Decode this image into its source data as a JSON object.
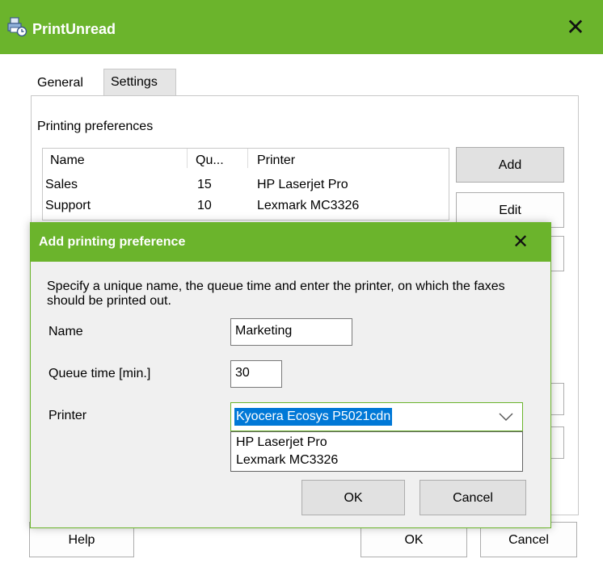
{
  "window": {
    "title": "PrintUnread",
    "app_icon": "printer-clock-icon",
    "close_glyph": "✕"
  },
  "tabs": [
    {
      "label": "General",
      "selected": false
    },
    {
      "label": "Settings",
      "selected": true
    }
  ],
  "settings": {
    "section_label": "Printing preferences",
    "columns": [
      "Name",
      "Qu...",
      "Printer"
    ],
    "rows": [
      {
        "name": "Sales",
        "queue": "15",
        "printer": "HP Laserjet Pro"
      },
      {
        "name": "Support",
        "queue": "10",
        "printer": "Lexmark MC3326"
      }
    ],
    "buttons": {
      "add": "Add",
      "edit": "Edit"
    }
  },
  "footer": {
    "help": "Help",
    "ok": "OK",
    "cancel": "Cancel"
  },
  "dialog": {
    "title": "Add printing preference",
    "close_glyph": "✕",
    "description": "Specify a unique name, the queue time and enter the printer, on which the faxes should be printed out.",
    "name_label": "Name",
    "name_value": "Marketing",
    "queue_label": "Queue time [min.]",
    "queue_value": "30",
    "printer_label": "Printer",
    "printer_value": "Kyocera Ecosys P5021cdn",
    "printer_options": [
      "HP Laserjet Pro",
      "Lexmark MC3326"
    ],
    "ok": "OK",
    "cancel": "Cancel"
  },
  "colors": {
    "accent": "#6bb42c",
    "selection": "#0078d7",
    "button_face": "#e1e1e1",
    "dialog_bg": "#f0f0f0"
  }
}
